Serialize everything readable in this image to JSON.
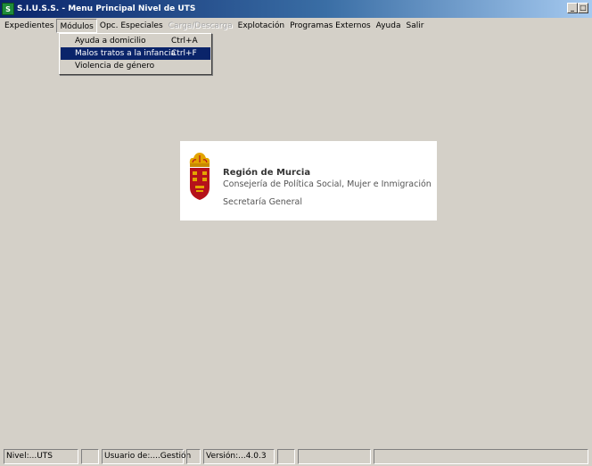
{
  "window": {
    "title": "S.I.U.S.S. - Menu Principal   Nivel de UTS",
    "icon_label": "S"
  },
  "menubar": {
    "items": [
      {
        "label": "Expedientes"
      },
      {
        "label": "Módulos"
      },
      {
        "label": "Opc. Especiales"
      },
      {
        "label": "Carga/Descarga"
      },
      {
        "label": "Explotación"
      },
      {
        "label": "Programas Externos"
      },
      {
        "label": "Ayuda"
      },
      {
        "label": "Salir"
      }
    ]
  },
  "modulos_menu": {
    "items": [
      {
        "label": "Ayuda a domicilio",
        "shortcut": "Ctrl+A"
      },
      {
        "label": "Malos tratos a la infancia",
        "shortcut": "Ctrl+F"
      },
      {
        "label": "Violencia de género",
        "shortcut": ""
      }
    ]
  },
  "logo": {
    "org_name": "Región de Murcia",
    "department": "Consejería de Política Social, Mujer e Inmigración",
    "secretaria": "Secretaría General"
  },
  "statusbar": {
    "nivel": "Nivel:...UTS",
    "usuario": "Usuario de:....Gestión",
    "version": "Versión:...4.0.3"
  },
  "colors": {
    "title_bar": "#0a246a",
    "menu_highlight": "#0a246a",
    "background": "#d4d0c8",
    "crest_red": "#b5121b",
    "crest_gold": "#e3a400"
  }
}
